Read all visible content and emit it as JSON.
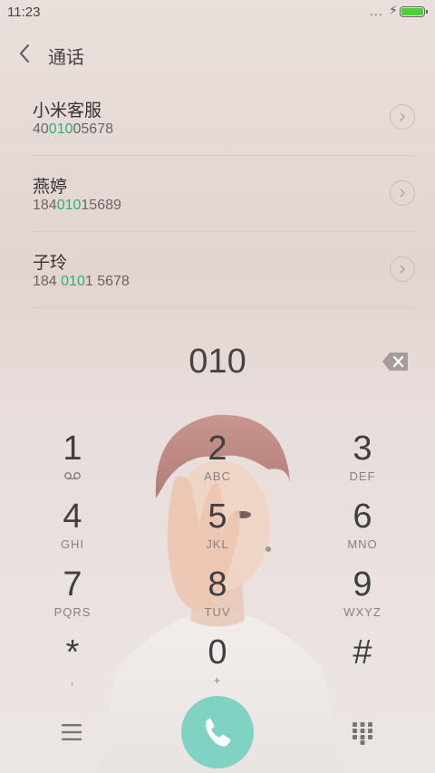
{
  "status_bar": {
    "time": "11:23",
    "dots": "...",
    "bolt": "⚡"
  },
  "header": {
    "title": "通话"
  },
  "results": [
    {
      "name": "小米客服",
      "num_pre": "40",
      "num_hl": "010",
      "num_post": "05678"
    },
    {
      "name": "燕婷",
      "num_pre": "184",
      "num_hl": "010",
      "num_post": "15689"
    },
    {
      "name": "子玲",
      "num_pre": "184 ",
      "num_hl": "010",
      "num_post": "1 5678"
    }
  ],
  "dialed": "010",
  "keys": [
    {
      "digit": "1",
      "letters": ""
    },
    {
      "digit": "2",
      "letters": "ABC"
    },
    {
      "digit": "3",
      "letters": "DEF"
    },
    {
      "digit": "4",
      "letters": "GHI"
    },
    {
      "digit": "5",
      "letters": "JKL"
    },
    {
      "digit": "6",
      "letters": "MNO"
    },
    {
      "digit": "7",
      "letters": "PQRS"
    },
    {
      "digit": "8",
      "letters": "TUV"
    },
    {
      "digit": "9",
      "letters": "WXYZ"
    },
    {
      "digit": "*",
      "letters": ","
    },
    {
      "digit": "0",
      "letters": "+"
    },
    {
      "digit": "#",
      "letters": ""
    }
  ],
  "colors": {
    "accent": "#2ab07a",
    "call_button": "#7ed3c3"
  }
}
